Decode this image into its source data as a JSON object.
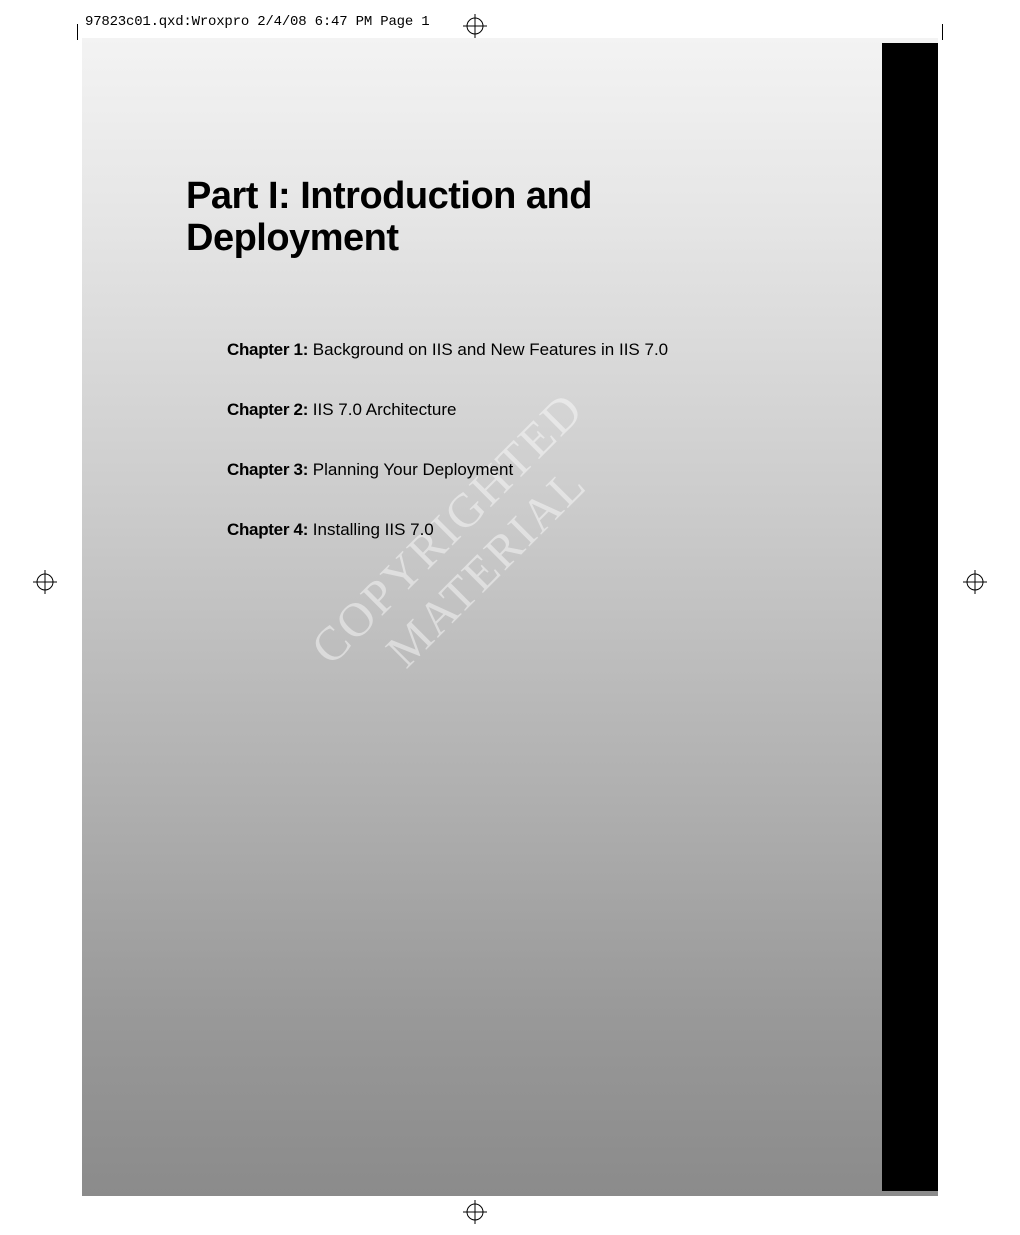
{
  "header": {
    "slug": "97823c01.qxd:Wroxpro  2/4/08  6:47 PM  Page 1"
  },
  "title": "Part I: Introduction and Deployment",
  "chapters": [
    {
      "label": "Chapter 1:",
      "title": " Background on IIS and New Features in IIS 7.0"
    },
    {
      "label": "Chapter 2:",
      "title": " IIS 7.0 Architecture"
    },
    {
      "label": "Chapter 3:",
      "title": " Planning Your Deployment"
    },
    {
      "label": "Chapter 4:",
      "title": " Installing IIS 7.0"
    }
  ],
  "watermark": "COPYRIGHTED MATERIAL"
}
